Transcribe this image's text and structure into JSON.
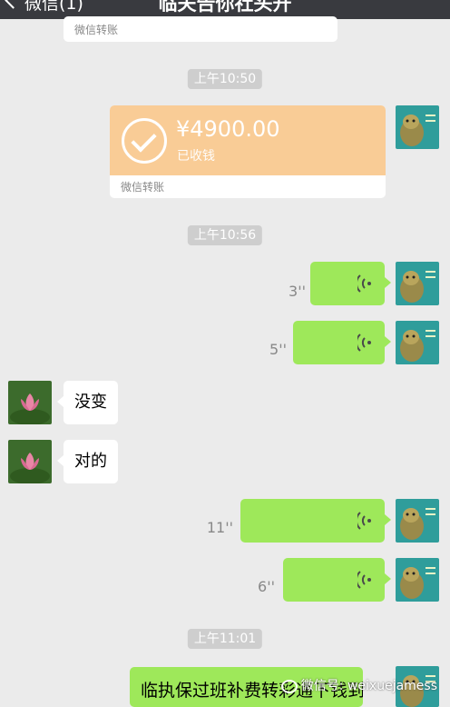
{
  "nav": {
    "back_label": "微信(1)",
    "title": "临夫告你社头开"
  },
  "messages": {
    "transfer_top": {
      "footer": "微信转账"
    },
    "ts1": "上午10:50",
    "transfer": {
      "amount": "¥4900.00",
      "status": "已收钱",
      "footer": "微信转账"
    },
    "ts2": "上午10:56",
    "voice1": "3''",
    "voice2": "5''",
    "incoming1": "没变",
    "incoming2": "对的",
    "voice3": "11''",
    "voice4": "6''",
    "ts3": "上午11:01",
    "last_text": "临执保过班补费转彩通下钱到"
  },
  "watermark": "微信号: weixuejamess",
  "colors": {
    "nav_bg": "#393a3f",
    "chat_bg": "#ebebeb",
    "voice_bubble": "#9ee85a",
    "transfer_accent": "#f9cc96"
  }
}
